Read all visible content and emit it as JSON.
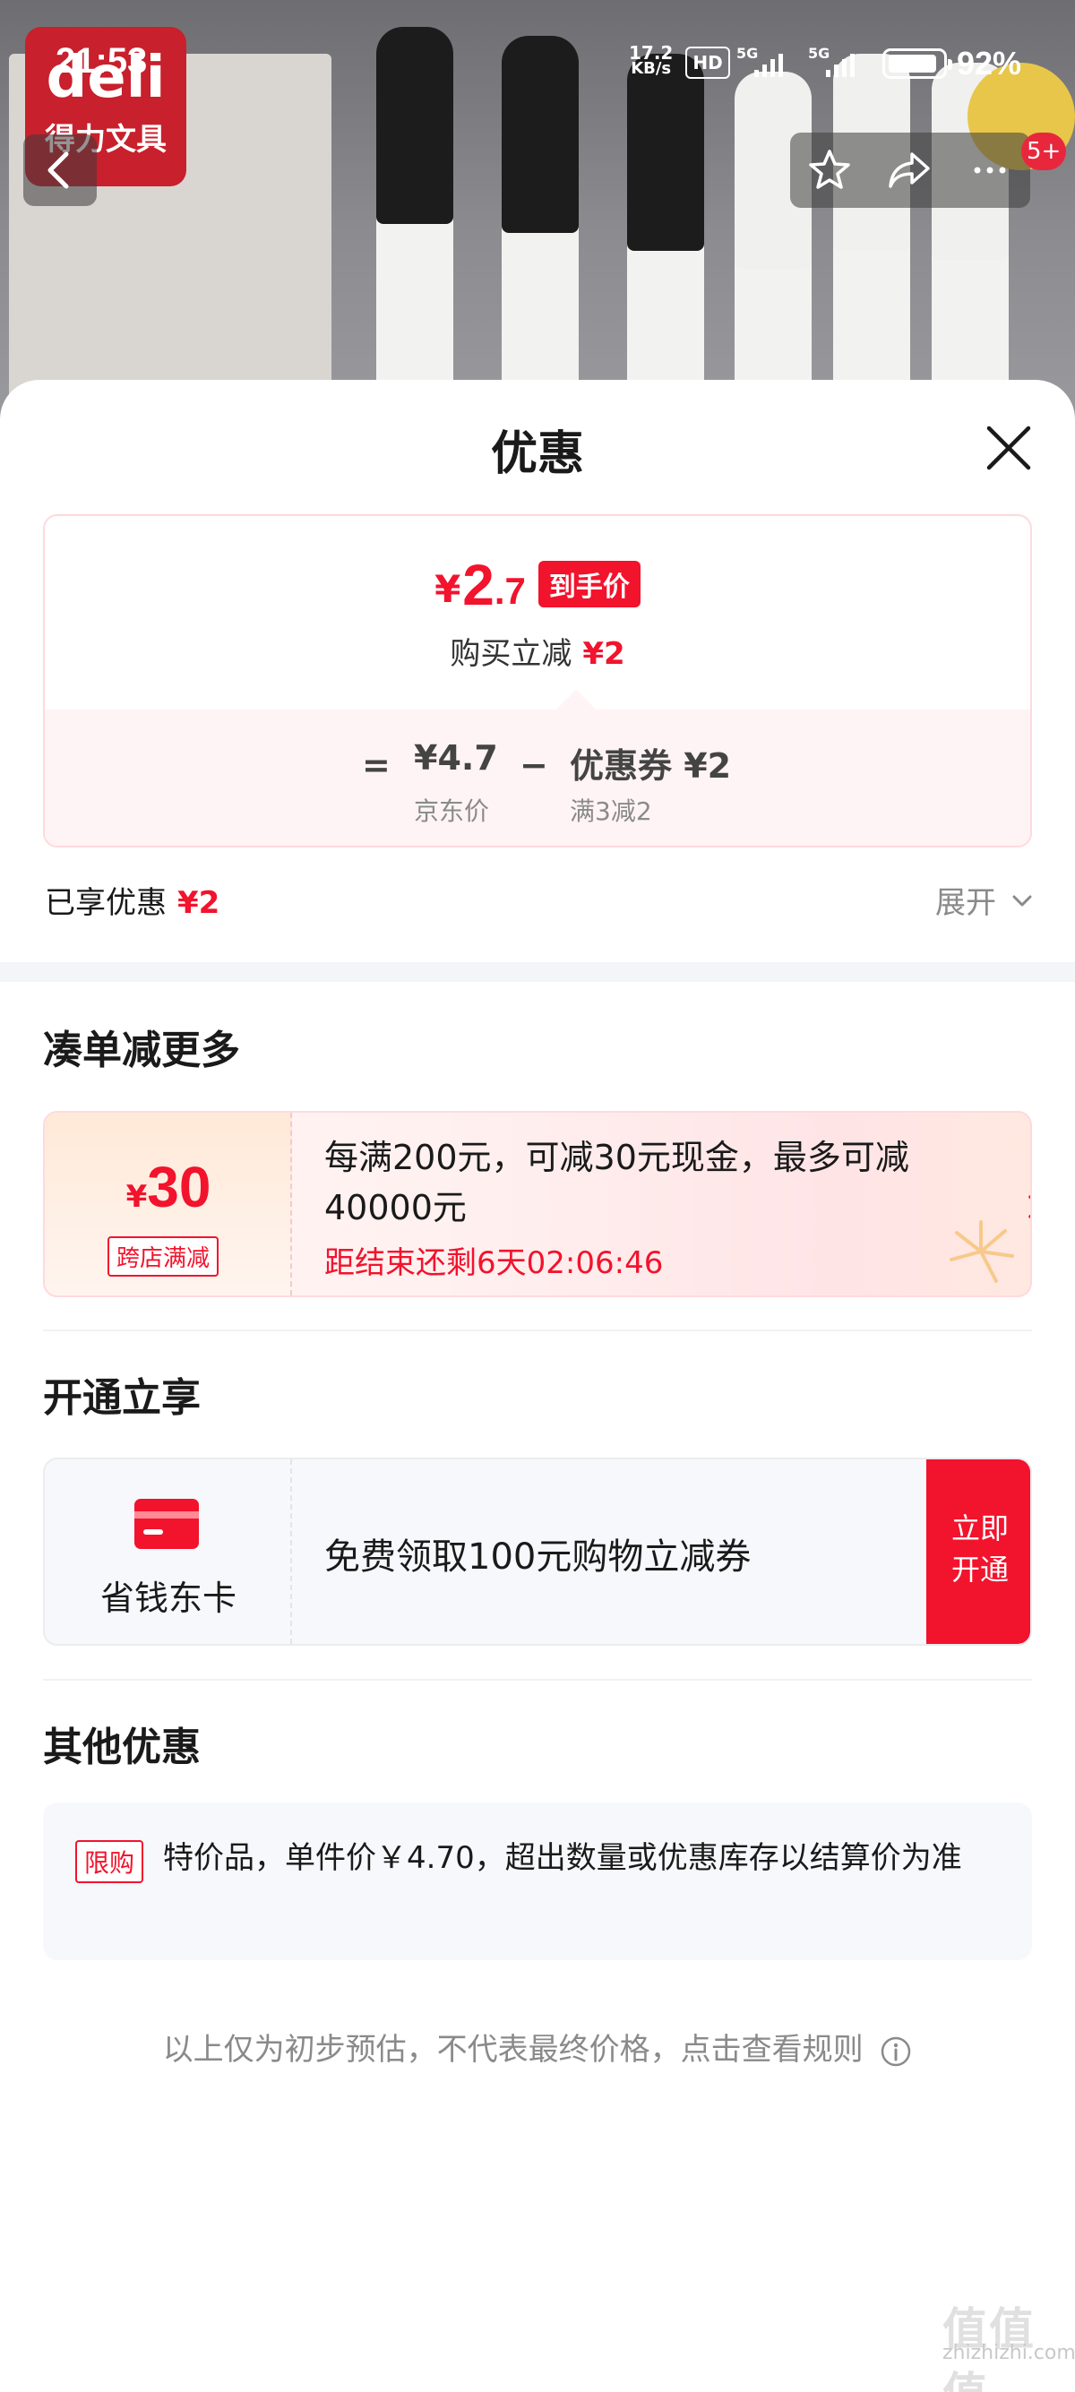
{
  "status_bar": {
    "time": "21:53",
    "net_speed": "17.2",
    "net_unit": "KB/s",
    "hd": "HD",
    "sim1": "5G",
    "sim2": "5G",
    "battery_pct": "92%",
    "battery_level": 0.92
  },
  "hero": {
    "brand_en": "deli",
    "brand_cn": "得力文具",
    "notification_badge": "5+"
  },
  "sheet": {
    "title": "优惠"
  },
  "price_card": {
    "yen": "¥",
    "price_int": "2",
    "price_dec": ".7",
    "final_tag": "到手价",
    "instant_label": "购买立减",
    "instant_amount": "¥2",
    "eq": "=",
    "base_price": "¥4.7",
    "base_label": "京东价",
    "minus": "−",
    "coupon": "优惠券 ¥2",
    "coupon_rule": "满3减2"
  },
  "enjoyed": {
    "label": "已享优惠",
    "amount": "¥2",
    "expand": "展开"
  },
  "section_more": {
    "title": "凑单减更多",
    "promo": {
      "yen": "¥",
      "amount": "30",
      "chip": "跨店满减",
      "desc": "每满200元，可减30元现金，最多可减40000元",
      "countdown": "距结束还剩6天02:06:46"
    }
  },
  "section_member": {
    "title": "开通立享",
    "card_name": "省钱东卡",
    "desc": "免费领取100元购物立减券",
    "btn_line1": "立即",
    "btn_line2": "开通"
  },
  "section_other": {
    "title": "其他优惠",
    "tag": "限购",
    "text": "特价品，单件价￥4.70，超出数量或优惠库存以结算价为准"
  },
  "footer": {
    "note": "以上仅为初步预估，不代表最终价格，点击查看规则"
  },
  "watermark": {
    "big": "值值值",
    "small": "zhizhizhi.com"
  },
  "colors": {
    "accent_red": "#f2132d",
    "text_primary": "#1a1a1a",
    "text_secondary": "#8a8a8a"
  }
}
